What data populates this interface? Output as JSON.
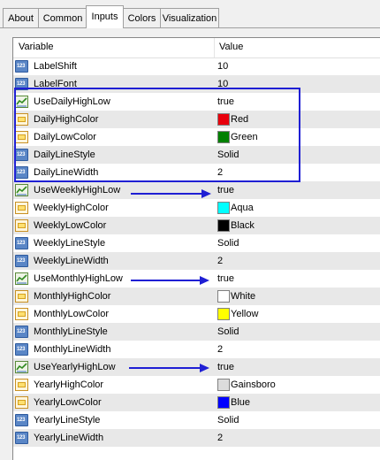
{
  "tabs": [
    {
      "label": "About",
      "active": false
    },
    {
      "label": "Common",
      "active": false
    },
    {
      "label": "Inputs",
      "active": true
    },
    {
      "label": "Colors",
      "active": false
    },
    {
      "label": "Visualization",
      "active": false
    }
  ],
  "grid": {
    "header": {
      "variable": "Variable",
      "value": "Value"
    },
    "rows": [
      {
        "icon": "number-icon",
        "name": "LabelShift",
        "value": "10"
      },
      {
        "icon": "number-icon",
        "name": "LabelFont",
        "value": "10"
      },
      {
        "icon": "bool-icon",
        "name": "UseDailyHighLow",
        "value": "true"
      },
      {
        "icon": "color-icon",
        "name": "DailyHighColor",
        "value": "Red",
        "color": "#e8000c"
      },
      {
        "icon": "color-icon",
        "name": "DailyLowColor",
        "value": "Green",
        "color": "#008000"
      },
      {
        "icon": "number-icon",
        "name": "DailyLineStyle",
        "value": "Solid"
      },
      {
        "icon": "number-icon",
        "name": "DailyLineWidth",
        "value": "2"
      },
      {
        "icon": "bool-icon",
        "name": "UseWeeklyHighLow",
        "value": "true"
      },
      {
        "icon": "color-icon",
        "name": "WeeklyHighColor",
        "value": "Aqua",
        "color": "#00ffff"
      },
      {
        "icon": "color-icon",
        "name": "WeeklyLowColor",
        "value": "Black",
        "color": "#000000"
      },
      {
        "icon": "number-icon",
        "name": "WeeklyLineStyle",
        "value": "Solid"
      },
      {
        "icon": "number-icon",
        "name": "WeeklyLineWidth",
        "value": "2"
      },
      {
        "icon": "bool-icon",
        "name": "UseMonthlyHighLow",
        "value": "true"
      },
      {
        "icon": "color-icon",
        "name": "MonthlyHighColor",
        "value": "White",
        "color": "#ffffff"
      },
      {
        "icon": "color-icon",
        "name": "MonthlyLowColor",
        "value": "Yellow",
        "color": "#ffff00"
      },
      {
        "icon": "number-icon",
        "name": "MonthlyLineStyle",
        "value": "Solid"
      },
      {
        "icon": "number-icon",
        "name": "MonthlyLineWidth",
        "value": "2"
      },
      {
        "icon": "bool-icon",
        "name": "UseYearlyHighLow",
        "value": "true"
      },
      {
        "icon": "color-icon",
        "name": "YearlyHighColor",
        "value": "Gainsboro",
        "color": "#dcdcdc"
      },
      {
        "icon": "color-icon",
        "name": "YearlyLowColor",
        "value": "Blue",
        "color": "#0000ff"
      },
      {
        "icon": "number-icon",
        "name": "YearlyLineStyle",
        "value": "Solid"
      },
      {
        "icon": "number-icon",
        "name": "YearlyLineWidth",
        "value": "2"
      }
    ]
  },
  "number_icon_text": "123",
  "annotation_color": "#1f1fd4"
}
